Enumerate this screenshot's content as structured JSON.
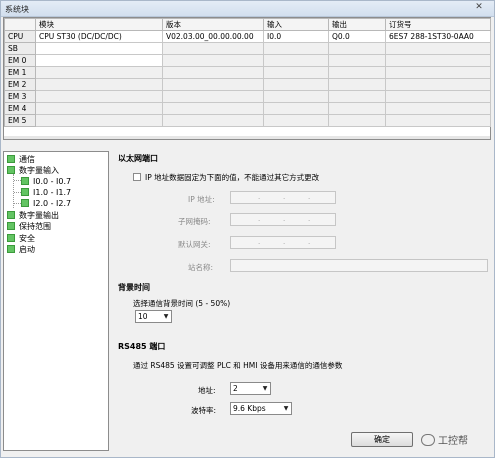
{
  "window": {
    "title": "系统块",
    "close_glyph": "✕"
  },
  "modules": {
    "columns": [
      "",
      "模块",
      "版本",
      "输入",
      "输出",
      "订货号"
    ],
    "rows": [
      {
        "slot": "CPU",
        "module": "CPU ST30 (DC/DC/DC)",
        "version": "V02.03.00_00.00.00.00",
        "input": "I0.0",
        "output": "Q0.0",
        "order": "6ES7 288-1ST30-0AA0"
      },
      {
        "slot": "SB",
        "module": "",
        "version": "",
        "input": "",
        "output": "",
        "order": ""
      },
      {
        "slot": "EM 0",
        "module": "",
        "version": "",
        "input": "",
        "output": "",
        "order": ""
      },
      {
        "slot": "EM 1",
        "module": "",
        "version": "",
        "input": "",
        "output": "",
        "order": ""
      },
      {
        "slot": "EM 2",
        "module": "",
        "version": "",
        "input": "",
        "output": "",
        "order": ""
      },
      {
        "slot": "EM 3",
        "module": "",
        "version": "",
        "input": "",
        "output": "",
        "order": ""
      },
      {
        "slot": "EM 4",
        "module": "",
        "version": "",
        "input": "",
        "output": "",
        "order": ""
      },
      {
        "slot": "EM 5",
        "module": "",
        "version": "",
        "input": "",
        "output": "",
        "order": ""
      }
    ]
  },
  "tree": {
    "items": [
      {
        "label": "通信"
      },
      {
        "label": "数字量输入"
      },
      {
        "label": "I0.0 - I0.7"
      },
      {
        "label": "I1.0 - I1.7"
      },
      {
        "label": "I2.0 - I2.7"
      },
      {
        "label": "数字量输出"
      },
      {
        "label": "保持范围"
      },
      {
        "label": "安全"
      },
      {
        "label": "启动"
      }
    ]
  },
  "ethernet": {
    "title": "以太网端口",
    "fixed_ip_label": "IP 地址数据固定为下面的值，不能通过其它方式更改",
    "ip_label": "IP 地址:",
    "subnet_label": "子网掩码:",
    "gateway_label": "默认网关:",
    "station_label": "站名称:",
    "ip_dot": "."
  },
  "background": {
    "title": "背景时间",
    "select_label": "选择通信背景时间 (5 - 50%)",
    "value": "10"
  },
  "rs485": {
    "title": "RS485 端口",
    "description": "通过 RS485 设置可调整 PLC 和 HMI 设备用来通信的通信参数",
    "address_label": "地址:",
    "address_value": "2",
    "baud_label": "波特率:",
    "baud_value": "9.6 Kbps"
  },
  "footer": {
    "ok_label": "确定",
    "watermark": "工控帮"
  },
  "colors": {
    "check_green": "#63c463"
  }
}
